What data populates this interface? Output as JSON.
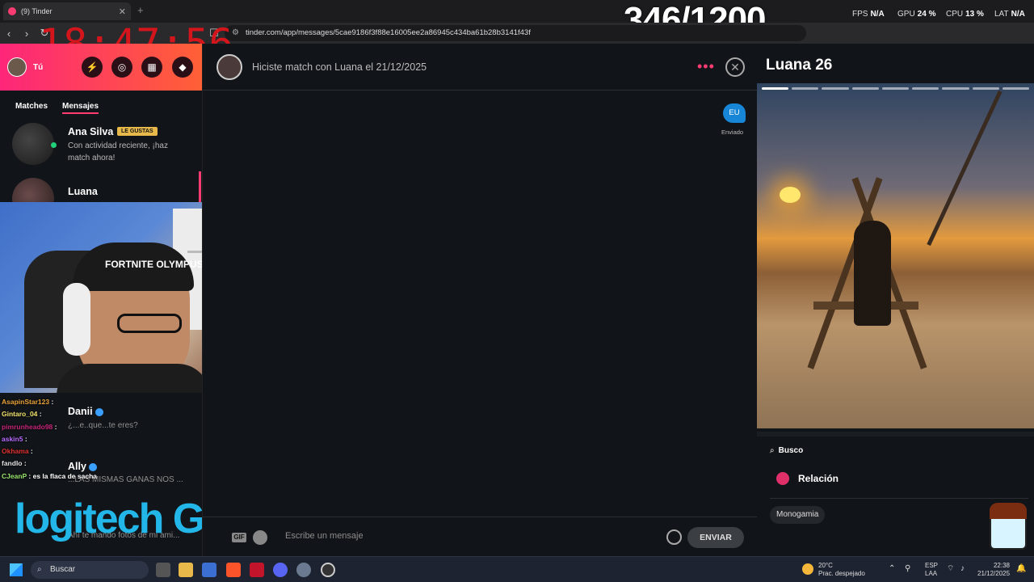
{
  "browser": {
    "tab_title": "(9) Tinder",
    "url": "tinder.com/app/messages/5cae9186f3f88e16005ee2a86945c434ba61b28b3141f43f",
    "clock_overlay": "18:47:56"
  },
  "stream_overlay": {
    "counter": "346/1200",
    "hud": [
      {
        "label": "FPS",
        "value": "N/A"
      },
      {
        "label": "GPU",
        "value": "24 %"
      },
      {
        "label": "CPU",
        "value": "13 %"
      },
      {
        "label": "LAT",
        "value": "N/A"
      }
    ],
    "webcam_cap_text": "FORTNITE OLYMPUS",
    "chat": [
      {
        "user": "AsapinStar123",
        "text": ":",
        "color": "#e8a23a"
      },
      {
        "user": "Gintaro_04",
        "text": ":",
        "color": "#f2e36c"
      },
      {
        "user": "pimrunheado98",
        "text": ":",
        "color": "#c6257a"
      },
      {
        "user": "askin5",
        "text": ":",
        "color": "#b86bff"
      },
      {
        "user": "Okhama",
        "text": ":",
        "color": "#e03030"
      },
      {
        "user": "fandlo",
        "text": ":",
        "color": "#e0e0e0"
      },
      {
        "user": "CJeanP",
        "text": ": es la flaca de sacha",
        "color": "#9be36f"
      }
    ],
    "logitech_logo": "logitech G"
  },
  "sidebar": {
    "user_label": "Tú",
    "tabs": [
      {
        "label": "Matches"
      },
      {
        "label": "Mensajes"
      }
    ],
    "conversations": [
      {
        "name": "Ana Silva",
        "badge": "LE GUSTAS",
        "message": "Con actividad reciente, ¡haz match ahora!"
      },
      {
        "name": "Luana",
        "badge": "",
        "message": ""
      }
    ],
    "lower_conversations": [
      {
        "name": "Danii",
        "message": "¿...e..que...te eres?"
      },
      {
        "name": "Ally",
        "message": "...LAS MISMAS GANAS NOS ..."
      },
      {
        "name": "",
        "message": "Ahí te mando fotos de mi ami..."
      }
    ]
  },
  "chat": {
    "header_title": "Hiciste match con Luana el 21/12/2025",
    "bubble_text": "EU",
    "sent_label": "Enviado",
    "composer": {
      "gif_label": "GIF",
      "placeholder": "Escribe un mensaje",
      "send_label": "ENVIAR"
    }
  },
  "profile": {
    "name_age": "Luana 26",
    "looking_for_label": "Busco",
    "relationship": "Relación",
    "chip": "Monogamia"
  },
  "taskbar": {
    "search_label": "Buscar",
    "weather_temp": "20°C",
    "weather_desc": "Prac. despejado",
    "lang_top": "ESP",
    "lang_bottom": "LAA",
    "time": "22:38",
    "date": "21/12/2025"
  },
  "colors": {
    "tinder_pink": "#fe3c72",
    "tinder_orange": "#ff6036",
    "bubble_blue": "#1786d6",
    "clock_red": "#e3141a"
  }
}
